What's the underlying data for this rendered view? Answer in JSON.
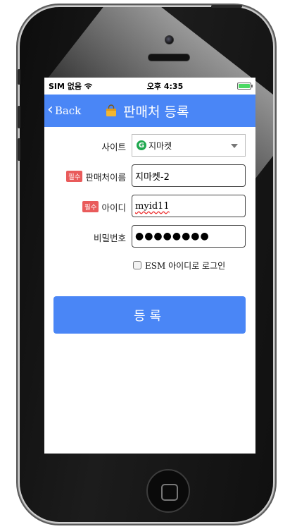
{
  "status": {
    "carrier": "SIM 없음",
    "time": "오후 4:35"
  },
  "nav": {
    "back_label": "Back",
    "title": "판매처 등록"
  },
  "form": {
    "site": {
      "label": "사이트",
      "value": "지마켓",
      "logo_letter": "G"
    },
    "seller_name": {
      "required_badge": "필수",
      "label": "판매처이름",
      "value": "지마켓-2"
    },
    "user_id": {
      "required_badge": "필수",
      "label": "아이디",
      "value": "myid11"
    },
    "password": {
      "label": "비밀번호",
      "value": "●●●●●●●●"
    },
    "esm_login": {
      "label": "ESM 아이디로 로그인",
      "checked": false
    }
  },
  "submit_label": "등록",
  "colors": {
    "accent": "#4a86f6",
    "required": "#e95b5b",
    "gmarket": "#1fa84f"
  }
}
